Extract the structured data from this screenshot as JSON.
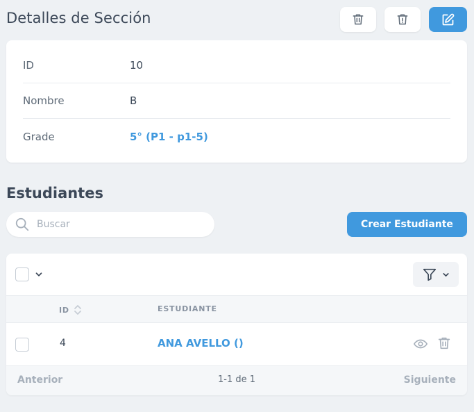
{
  "page": {
    "title": "Detalles de Sección",
    "actions": {
      "delete_icon": "trash-icon",
      "warn_delete_icon": "trash-alert-icon",
      "edit_icon": "edit-icon"
    }
  },
  "details": {
    "rows": [
      {
        "label": "ID",
        "value": "10"
      },
      {
        "label": "Nombre",
        "value": "B"
      },
      {
        "label": "Grade",
        "value": "5° (P1 - p1-5)"
      }
    ]
  },
  "students": {
    "title": "Estudiantes",
    "search_placeholder": "Buscar",
    "search_value": "",
    "create_label": "Crear Estudiante",
    "columns": {
      "id": "ID",
      "student": "ESTUDIANTE"
    },
    "rows": [
      {
        "id": "4",
        "name": "ANA AVELLO ()"
      }
    ],
    "pager": {
      "prev": "Anterior",
      "info": "1-1 de 1",
      "next": "Siguiente"
    }
  },
  "colors": {
    "accent": "#4099de",
    "background": "#eef1f4",
    "text": "#3c4858",
    "muted": "#a7b0bb"
  }
}
